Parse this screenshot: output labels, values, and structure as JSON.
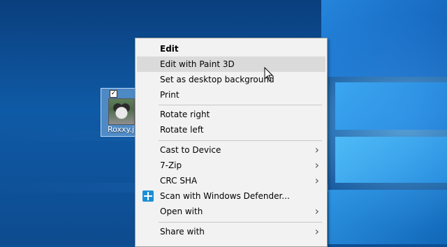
{
  "desktop": {
    "file_icon": {
      "name": "Roxxy.jp",
      "checked": true
    }
  },
  "context_menu": {
    "items": [
      {
        "label": "Edit",
        "bold": true,
        "submenu": false
      },
      {
        "label": "Edit with Paint 3D",
        "highlighted": true,
        "submenu": false
      },
      {
        "label": "Set as desktop background",
        "submenu": false
      },
      {
        "label": "Print",
        "submenu": false
      },
      {
        "label": "Rotate right",
        "submenu": false
      },
      {
        "label": "Rotate left",
        "submenu": false
      },
      {
        "label": "Cast to Device",
        "submenu": true
      },
      {
        "label": "7-Zip",
        "submenu": true
      },
      {
        "label": "CRC SHA",
        "submenu": true
      },
      {
        "label": "Scan with Windows Defender...",
        "icon": "windows-defender-icon",
        "submenu": false
      },
      {
        "label": "Open with",
        "submenu": true
      },
      {
        "label": "Share with",
        "submenu": true
      }
    ],
    "submenu_arrow": "›"
  },
  "colors": {
    "menu_background": "#f2f2f2",
    "menu_highlight": "#dadada",
    "desktop_blue": "#0f5aa6"
  }
}
